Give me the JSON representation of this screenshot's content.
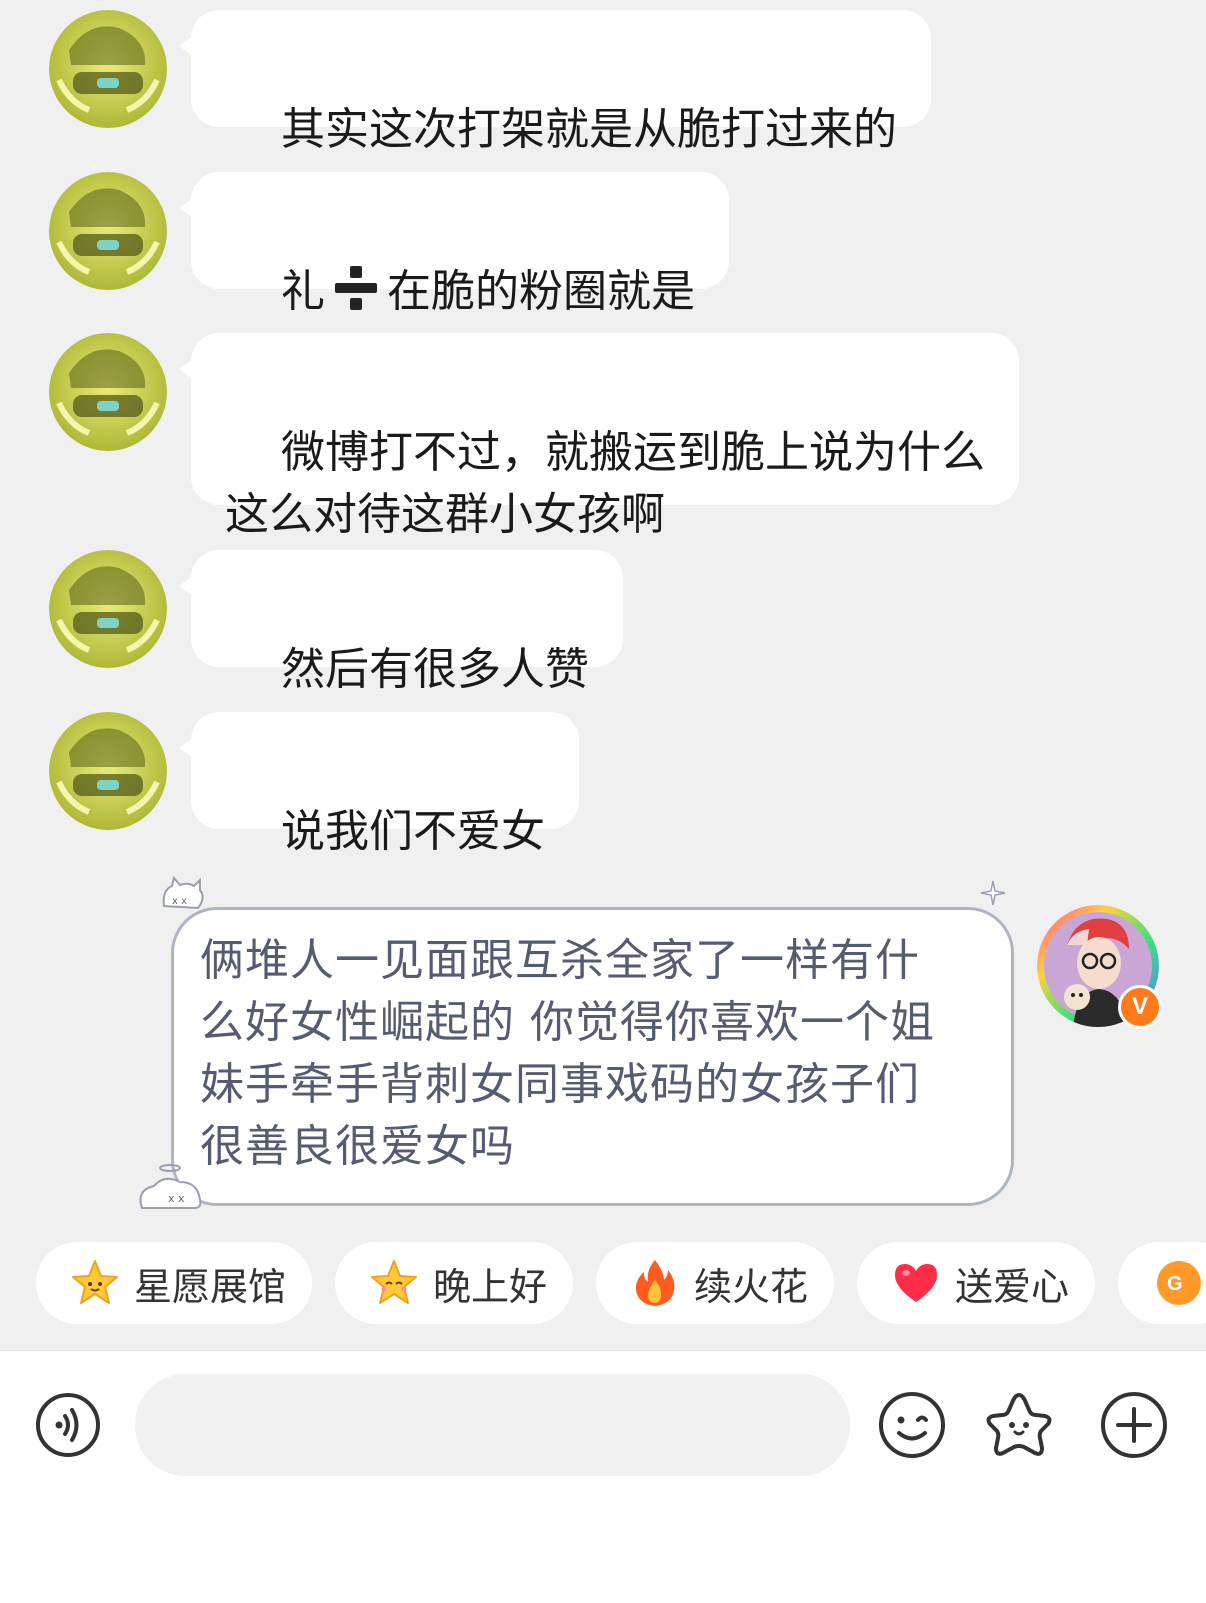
{
  "messages": [
    {
      "side": "left",
      "text": "其实这次打架就是从脆打过来的"
    },
    {
      "side": "left",
      "text_before": "礼",
      "text_after": "在脆的粉圈就是",
      "glyph": "division-sign"
    },
    {
      "side": "left",
      "text": "微博打不过，就搬运到脆上说为什么\n这么对待这群小女孩啊"
    },
    {
      "side": "left",
      "text": "然后有很多人赞"
    },
    {
      "side": "left",
      "text": "说我们不爱女"
    }
  ],
  "my_message": {
    "lines": [
      "俩堆人一见面跟互杀全家了一样有什",
      "么好女性崛起的 你觉得你喜欢一个姐",
      "妹手牵手背刺女同事戏码的女孩子们",
      "很善良很爱女吗"
    ],
    "badge": "V"
  },
  "quick_actions": [
    {
      "label": "星愿展馆",
      "icon": "star-face-icon"
    },
    {
      "label": "晚上好",
      "icon": "star-face-icon"
    },
    {
      "label": "续火花",
      "icon": "fire-icon"
    },
    {
      "label": "送爱心",
      "icon": "heart-icon"
    },
    {
      "label": "",
      "icon": "gift-icon"
    }
  ],
  "toolbar": {
    "voice_icon": "voice-icon",
    "input_placeholder": "",
    "emoji_icon": "smiley-icon",
    "sticker_icon": "star-sticker-icon",
    "plus_icon": "plus-icon"
  },
  "colors": {
    "background": "#f0f0f0",
    "bubble": "#ffffff",
    "my_bubble_border": "#aeb4c4",
    "my_bubble_text": "#555c70",
    "badge": "#ff7a1a",
    "avatar_tint": "#d8df4a"
  }
}
